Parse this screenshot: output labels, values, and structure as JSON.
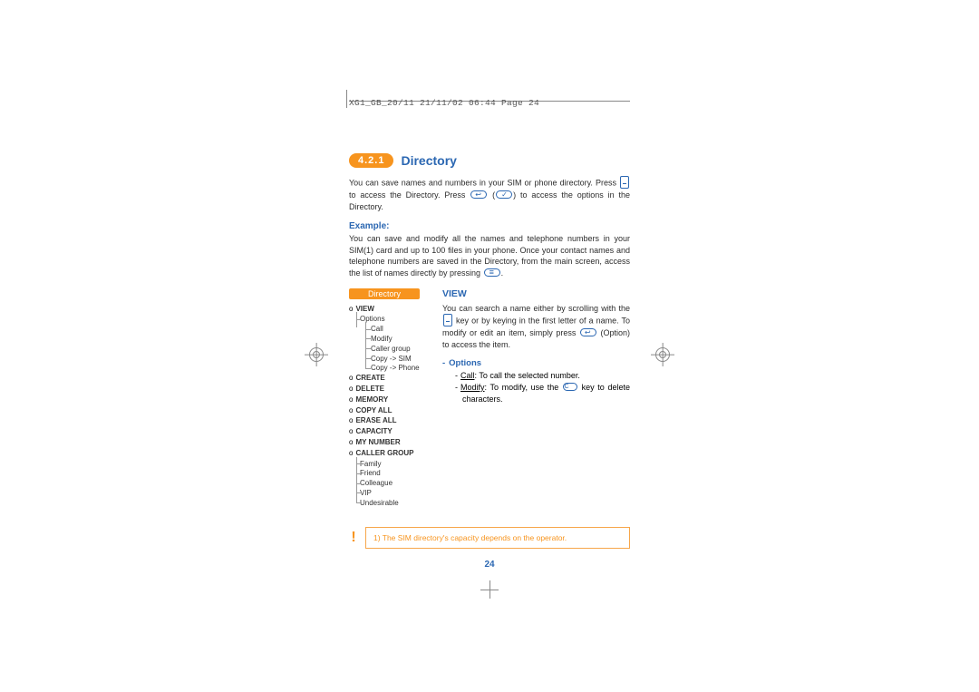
{
  "header": "XG1_GB_20/11  21/11/02  06:44  Page 24",
  "section": {
    "number": "4.2.1",
    "title": "Directory"
  },
  "intro": {
    "p1a": "You can save names and numbers in your SIM or phone directory. Press",
    "p1b": "to access the Directory. Press",
    "p1c": "(",
    "p1d": ") to access the options in the Directory."
  },
  "example": {
    "label": "Example:",
    "text_a": "You can save and modify all the names and telephone numbers in your SIM(1) card and up to 100 files in your phone. Once your contact names and telephone numbers are saved in the Directory, from the main screen, access the list of names directly by pressing",
    "text_b": "."
  },
  "tree": {
    "tab": "Directory",
    "items": [
      {
        "l": 1,
        "t": "VIEW",
        "bold": true
      },
      {
        "l": 2,
        "t": "Options",
        "cont": true
      },
      {
        "l": 3,
        "t": "Call",
        "cont": true
      },
      {
        "l": 3,
        "t": "Modify",
        "cont": true
      },
      {
        "l": 3,
        "t": "Caller group",
        "cont": true
      },
      {
        "l": 3,
        "t": "Copy -> SIM",
        "cont": true
      },
      {
        "l": 3,
        "t": "Copy -> Phone"
      },
      {
        "l": 1,
        "t": "CREATE",
        "bold": true
      },
      {
        "l": 1,
        "t": "DELETE",
        "bold": true
      },
      {
        "l": 1,
        "t": "MEMORY",
        "bold": true
      },
      {
        "l": 1,
        "t": "COPY ALL",
        "bold": true
      },
      {
        "l": 1,
        "t": "ERASE ALL",
        "bold": true
      },
      {
        "l": 1,
        "t": "CAPACITY",
        "bold": true
      },
      {
        "l": 1,
        "t": "MY NUMBER",
        "bold": true
      },
      {
        "l": 1,
        "t": "CALLER GROUP",
        "bold": true
      },
      {
        "l": 2,
        "t": "Family",
        "cont": true
      },
      {
        "l": 2,
        "t": "Friend",
        "cont": true
      },
      {
        "l": 2,
        "t": "Colleague",
        "cont": true
      },
      {
        "l": 2,
        "t": "VIP",
        "cont": true
      },
      {
        "l": 2,
        "t": "Undesirable"
      }
    ]
  },
  "view": {
    "heading": "VIEW",
    "body_a": "You can search a name either by scrolling with the",
    "body_b": "key or by keying in the first letter of a name. To modify or edit an item, simply press",
    "body_c": "(Option) to access the item.",
    "opts_label": "Options",
    "call_label": "Call",
    "call_text": ": To call the selected number.",
    "modify_label": "Modify",
    "modify_text_a": ": To modify, use the",
    "modify_text_b": "key to delete characters."
  },
  "footnote": "1)  The SIM directory's capacity depends on the operator.",
  "pagenum": "24"
}
